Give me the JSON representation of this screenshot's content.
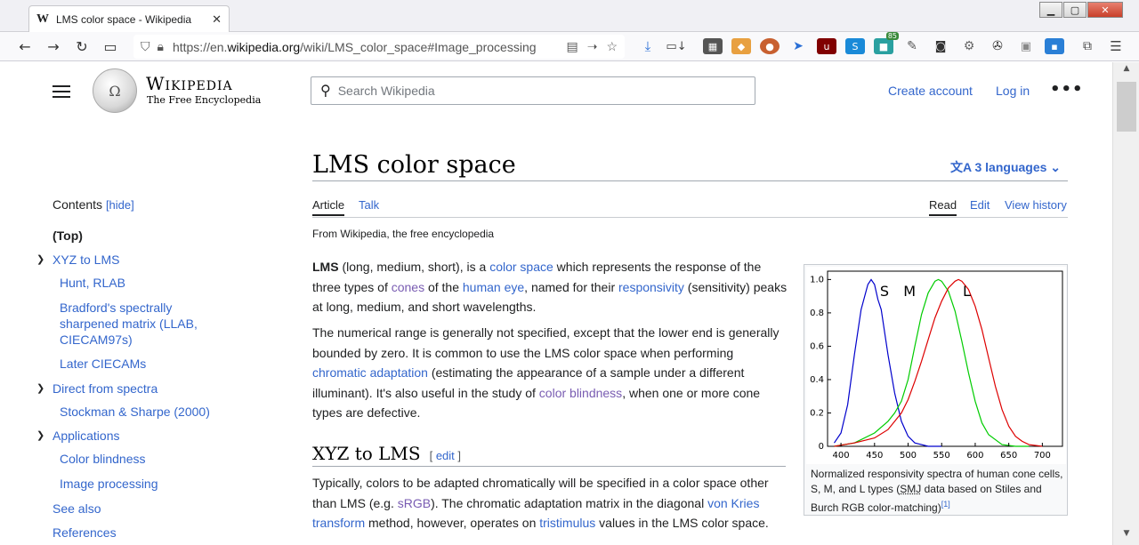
{
  "browser": {
    "tab_title": "LMS color space - Wikipedia",
    "tab_favicon": "W",
    "url_prefix": "https://en.",
    "url_domain": "wikipedia.org",
    "url_path": "/wiki/LMS_color_space#Image_processing",
    "badge_count": "85"
  },
  "header": {
    "wordmark": "Wikipedia",
    "tagline": "The Free Encyclopedia",
    "search_placeholder": "Search Wikipedia",
    "create_account": "Create account",
    "login": "Log in"
  },
  "toc": {
    "title": "Contents",
    "hide": "[hide]",
    "items": [
      "(Top)",
      "XYZ to LMS",
      "Hunt, RLAB",
      "Bradford's spectrally sharpened matrix (LLAB, CIECAM97s)",
      "Later CIECAMs",
      "Direct from spectra",
      "Stockman & Sharpe (2000)",
      "Applications",
      "Color blindness",
      "Image processing",
      "See also",
      "References"
    ]
  },
  "article": {
    "title": "LMS color space",
    "languages": "3 languages",
    "tabs": [
      "Article",
      "Talk"
    ],
    "actions": [
      "Read",
      "Edit",
      "View history"
    ],
    "from": "From Wikipedia, the free encyclopedia",
    "p1": {
      "b": "LMS",
      "t1": " (long, medium, short), is a ",
      "l1": "color space",
      "t2": " which represents the response of the three types of ",
      "l2": "cones",
      "t3": " of the ",
      "l3": "human eye",
      "t4": ", named for their ",
      "l4": "responsivity",
      "t5": " (sensitivity) peaks at long, medium, and short wavelengths."
    },
    "p2": {
      "t1": "The numerical range is generally not specified, except that the lower end is generally bounded by zero. It is common to use the LMS color space when performing ",
      "l1": "chromatic adaptation",
      "t2": " (estimating the appearance of a sample under a different illuminant). It's also useful in the study of ",
      "l2": "color blindness",
      "t3": ", when one or more cone types are defective."
    },
    "h2": "XYZ to LMS",
    "h2_edit": "edit",
    "p3": {
      "t1": "Typically, colors to be adapted chromatically will be specified in a color space other than LMS (e.g. ",
      "l1": "sRGB",
      "t2": "). The chromatic adaptation matrix in the diagonal ",
      "l2": "von Kries transform",
      "t3": " method, however, operates on ",
      "l3": "tristimulus",
      "t4": " values in the LMS color space."
    }
  },
  "figure": {
    "caption_t1": "Normalized responsivity spectra of human cone cells, S, M, and L types (",
    "caption_abbr": "SMJ",
    "caption_t2": " data based on Stiles and Burch RGB color-matching)",
    "caption_ref": "[1]"
  },
  "chart_data": {
    "type": "line",
    "title": "",
    "xlabel": "",
    "ylabel": "",
    "xlim": [
      380,
      730
    ],
    "ylim": [
      0,
      1.05
    ],
    "xticks": [
      400,
      450,
      500,
      550,
      600,
      650,
      700
    ],
    "yticks": [
      0,
      0.2,
      0.4,
      0.6,
      0.8,
      1.0
    ],
    "ytick_labels": [
      "0",
      "0.2",
      "0.4",
      "0.6",
      "0.8",
      "1.0"
    ],
    "annotations": [
      "S",
      "M",
      "L"
    ],
    "series": [
      {
        "name": "S",
        "color": "#0000cc",
        "x": [
          390,
          400,
          410,
          420,
          430,
          440,
          445,
          450,
          455,
          460,
          470,
          480,
          490,
          500,
          510,
          520,
          530,
          550
        ],
        "y": [
          0.02,
          0.08,
          0.25,
          0.55,
          0.82,
          0.97,
          1.0,
          0.97,
          0.88,
          0.82,
          0.55,
          0.32,
          0.15,
          0.06,
          0.02,
          0.01,
          0.0,
          0.0
        ]
      },
      {
        "name": "M",
        "color": "#00cc00",
        "x": [
          390,
          420,
          450,
          470,
          480,
          490,
          500,
          510,
          520,
          530,
          540,
          545,
          550,
          560,
          570,
          580,
          590,
          600,
          610,
          620,
          640,
          660,
          680
        ],
        "y": [
          0.0,
          0.02,
          0.08,
          0.15,
          0.2,
          0.27,
          0.4,
          0.6,
          0.79,
          0.92,
          0.99,
          1.0,
          0.99,
          0.93,
          0.81,
          0.63,
          0.44,
          0.27,
          0.14,
          0.07,
          0.01,
          0.0,
          0.0
        ]
      },
      {
        "name": "L",
        "color": "#dd0000",
        "x": [
          390,
          420,
          450,
          470,
          490,
          500,
          510,
          520,
          530,
          540,
          550,
          560,
          570,
          575,
          580,
          590,
          600,
          610,
          620,
          630,
          640,
          650,
          660,
          670,
          680,
          700
        ],
        "y": [
          0.0,
          0.02,
          0.05,
          0.1,
          0.2,
          0.28,
          0.39,
          0.51,
          0.64,
          0.77,
          0.87,
          0.95,
          0.99,
          1.0,
          0.99,
          0.94,
          0.84,
          0.7,
          0.53,
          0.36,
          0.22,
          0.12,
          0.06,
          0.03,
          0.01,
          0.0
        ]
      }
    ]
  }
}
